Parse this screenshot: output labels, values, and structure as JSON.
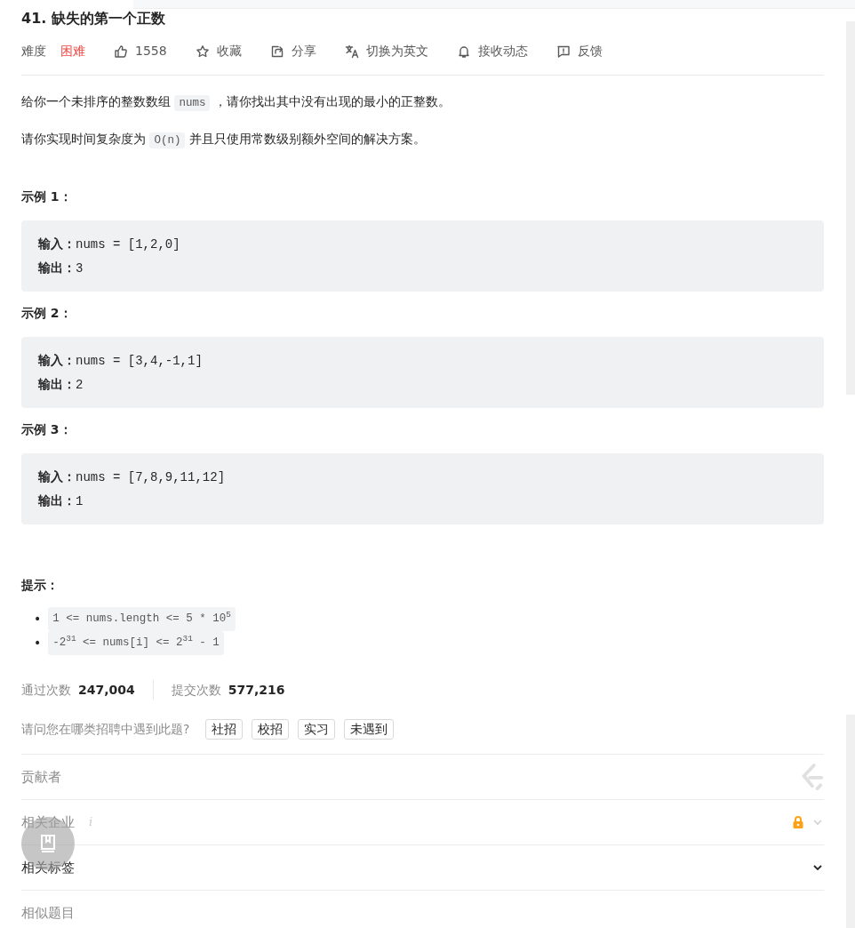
{
  "title": "41. 缺失的第一个正数",
  "meta": {
    "difficulty_label": "难度",
    "difficulty": "困难",
    "likes": "1558",
    "actions": [
      {
        "kind": "star",
        "label": "收藏"
      },
      {
        "kind": "share",
        "label": "分享"
      },
      {
        "kind": "translate",
        "label": "切换为英文"
      },
      {
        "kind": "bell",
        "label": "接收动态"
      },
      {
        "kind": "feedback",
        "label": "反馈"
      }
    ]
  },
  "paragraphs": [
    [
      {
        "text": "给你一个未排序的整数数组 ",
        "code": false
      },
      {
        "text": "nums",
        "code": true
      },
      {
        "text": " ，请你找出其中没有出现的最小的正整数。",
        "code": false
      }
    ],
    [
      {
        "text": "请你实现时间复杂度为 ",
        "code": false
      },
      {
        "text": "O(n)",
        "code": true
      },
      {
        "text": " 并且只使用常数级别额外空间的解决方案。",
        "code": false
      }
    ]
  ],
  "examples": [
    {
      "heading": "示例 1：",
      "input_label": "输入：",
      "input": "nums = [1,2,0]",
      "output_label": "输出：",
      "output": "3"
    },
    {
      "heading": "示例 2：",
      "input_label": "输入：",
      "input": "nums = [3,4,-1,1]",
      "output_label": "输出：",
      "output": "2"
    },
    {
      "heading": "示例 3：",
      "input_label": "输入：",
      "input": "nums = [7,8,9,11,12]",
      "output_label": "输出：",
      "output": "1"
    }
  ],
  "hints": {
    "heading": "提示：",
    "items": [
      {
        "marker": "•",
        "text": "1 <= nums.length <= 5 * 10$^{5}$"
      },
      {
        "marker": "•",
        "text": "-2$^{31}$ <= nums[i] <= 2$^{31}$ - 1"
      }
    ]
  },
  "stats": [
    {
      "label": "通过次数",
      "value": "247,004"
    },
    {
      "label": "提交次数",
      "value": "577,216"
    }
  ],
  "survey": {
    "question": "请问您在哪类招聘中遇到此题?",
    "options": [
      "社招",
      "校招",
      "实习",
      "未遇到"
    ]
  },
  "sections": [
    {
      "kind": "contributors",
      "label": "贡献者",
      "highlighted": false
    },
    {
      "kind": "companies",
      "label": "相关企业",
      "info": "i",
      "highlighted": false,
      "locked": true
    },
    {
      "kind": "tags",
      "label": "相关标签",
      "highlighted": true
    },
    {
      "kind": "similar",
      "label": "相似题目",
      "highlighted": false
    }
  ]
}
